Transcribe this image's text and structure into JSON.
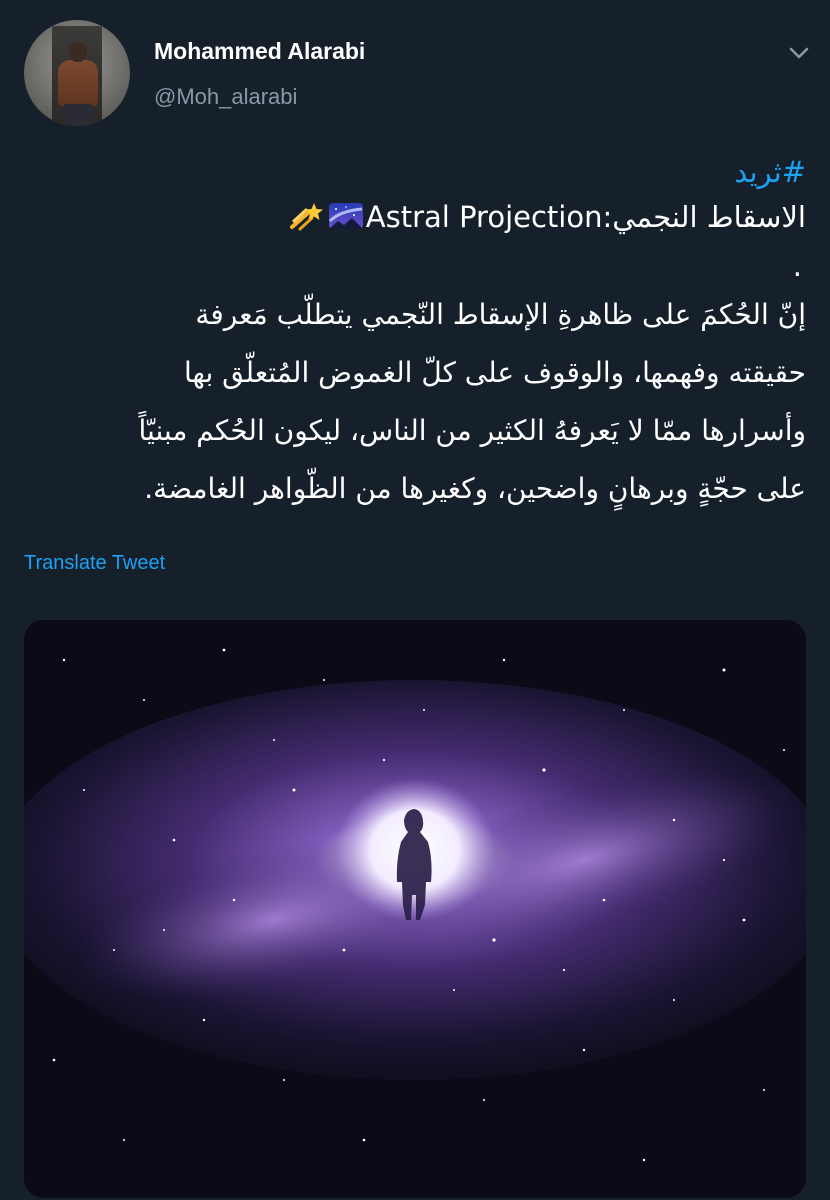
{
  "user": {
    "name": "Mohammed Alarabi",
    "handle": "@Moh_alarabi"
  },
  "tweet": {
    "hashtag": "#ثريد",
    "title_text": "الاسقاط النجمي:Astral Projection",
    "dot": ".",
    "lines": [
      "إنّ الحُكمَ على ظاهرةِ الإسقاط النّجمي يتطلّب مَعرفة",
      "حقيقته وفهمها، والوقوف على كلّ الغموض المُتعلّق بها",
      "وأسرارها ممّا لا يَعرفهُ الكثير من الناس، ليكون الحُكم مبنيّاً",
      "على حجّةٍ وبرهانٍ واضحين، وكغيرها من الظّواهر الغامضة."
    ],
    "translate_label": "Translate Tweet",
    "emojis": [
      "shooting-star-icon",
      "milky-way-icon"
    ]
  },
  "colors": {
    "background": "#15202b",
    "link": "#1da1f2",
    "secondary_text": "#8899a6"
  },
  "media": {
    "description_icon": "galaxy-portal-image"
  }
}
